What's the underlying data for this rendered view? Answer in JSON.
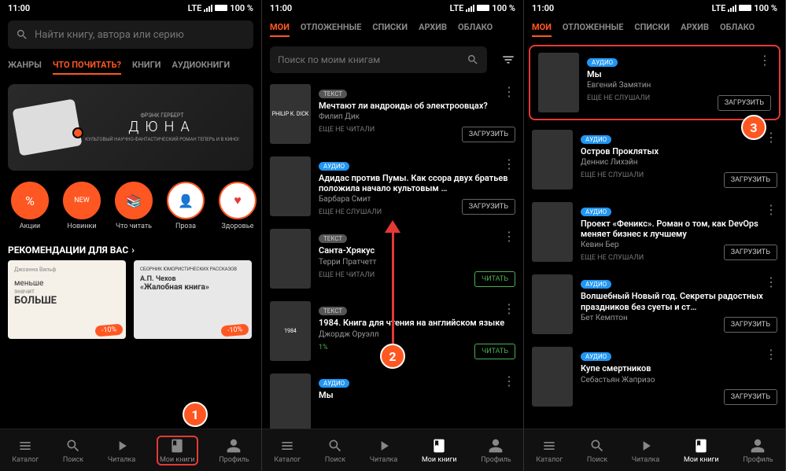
{
  "status": {
    "time": "11:00",
    "net": "LTE",
    "batt": "100 %"
  },
  "screen1": {
    "search_placeholder": "Найти книгу, автора или серию",
    "tabs": [
      "ЖАНРЫ",
      "ЧТО ПОЧИТАТЬ?",
      "КНИГИ",
      "АУДИОКНИГИ"
    ],
    "banner": {
      "author": "ФРЭНК ГЕРБЕРТ",
      "title": "ДЮНА",
      "sub": "КУЛЬТОВЫЙ НАУЧНО-ФАНТАСТИЧЕСКИЙ РОМАН ТЕПЕРЬ И В КИНО!"
    },
    "circles": [
      "Акции",
      "Новинки",
      "Что читать",
      "Проза",
      "Здоровье"
    ],
    "section": "РЕКОМЕНДАЦИИ ДЛЯ ВАС",
    "cards": [
      {
        "a": "Джоанна Вильф",
        "t1": "меньше",
        "t2": "значит",
        "t3": "БОЛЬШЕ",
        "discount": "-10%"
      },
      {
        "a": "СБОРНИК ЮМОРИСТИЧЕСКИХ РАССКАЗОВ",
        "t1": "А.П. Чехов",
        "t2": "«Жалобная книга»",
        "discount": "-10%"
      }
    ]
  },
  "subtabs": [
    "МОИ",
    "ОТЛОЖЕННЫЕ",
    "СПИСКИ",
    "АРХИВ",
    "ОБЛАКО"
  ],
  "screen2": {
    "search_placeholder": "Поиск по моим книгам",
    "items": [
      {
        "badge": "ТЕКСТ",
        "title": "Мечтают ли андроиды об электроовцах?",
        "author": "Филип Дик",
        "status": "ЕЩЕ НЕ ЧИТАЛИ",
        "btn": "ЗАГРУЗИТЬ",
        "cover": "PHILIP K. DICK"
      },
      {
        "badge": "АУДИО",
        "title": "Адидас против Пумы. Как ссора двух братьев положила начало культовым …",
        "author": "Барбара Смит",
        "status": "ЕЩЕ НЕ СЛУШАЛИ",
        "btn": "ЗАГРУЗИТЬ"
      },
      {
        "badge": "ТЕКСТ",
        "title": "Санта-Хрякус",
        "author": "Терри Пратчетт",
        "status": "ЕЩЕ НЕ ЧИТАЛИ",
        "btn": "ЧИТАТЬ",
        "green": true
      },
      {
        "badge": "ТЕКСТ",
        "title": "1984. Книга для чтения на английском языке",
        "author": "Джордж Оруэлл",
        "progress": "1%",
        "btn": "ЧИТАТЬ",
        "green": true,
        "cover": "1984"
      },
      {
        "badge": "АУДИО",
        "title": "Мы",
        "author": ""
      }
    ]
  },
  "screen3": {
    "items": [
      {
        "badge": "АУДИО",
        "title": "Мы",
        "author": "Евгений Замятин",
        "status": "ЕЩЕ НЕ СЛУШАЛИ",
        "btn": "ЗАГРУЗИТЬ",
        "highlight": true
      },
      {
        "badge": "АУДИО",
        "title": "Остров Проклятых",
        "author": "Деннис Лихэйн",
        "status": "ЕЩЕ НЕ СЛУШАЛИ",
        "btn": "ЗАГРУЗИТЬ"
      },
      {
        "badge": "АУДИО",
        "title": "Проект «Феникс». Роман о том, как DevOps меняет бизнес к лучшему",
        "author": "Кевин Бер",
        "status": "ЕЩЕ НЕ СЛУШАЛИ",
        "btn": "ЗАГРУЗИТЬ"
      },
      {
        "badge": "АУДИО",
        "title": "Волшебный Новый год. Секреты радостных праздников без суеты и ст…",
        "author": "Бет Кемптон",
        "status": "",
        "btn": "ЗАГРУЗИТЬ"
      },
      {
        "badge": "АУДИО",
        "title": "Купе смертников",
        "author": "Себастьян Жапризо",
        "status": "",
        "btn": "ЗАГРУЗИТЬ"
      }
    ]
  },
  "nav": [
    "Каталог",
    "Поиск",
    "Читалка",
    "Мои книги",
    "Профиль"
  ],
  "steps": {
    "1": "1",
    "2": "2",
    "3": "3"
  }
}
